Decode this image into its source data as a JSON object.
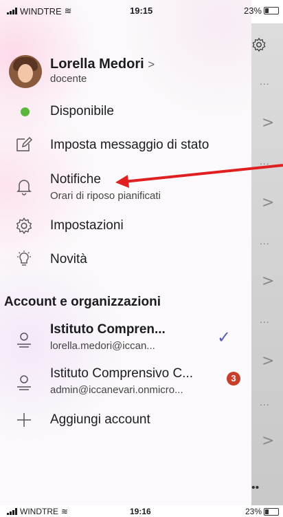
{
  "status_top": {
    "carrier": "WINDTRE",
    "time": "19:15",
    "battery": "23%"
  },
  "status_bottom": {
    "carrier": "WINDTRE",
    "time": "19:16",
    "battery": "23%"
  },
  "profile": {
    "name": "Lorella Medori",
    "chevron": ">",
    "role": "docente"
  },
  "menu": {
    "availability": "Disponibile",
    "set_status": "Imposta messaggio di stato",
    "notifications": "Notifiche",
    "notifications_sub": "Orari di riposo pianificati",
    "settings": "Impostazioni",
    "whats_new": "Novità"
  },
  "accounts": {
    "heading": "Account e organizzazioni",
    "items": [
      {
        "name": "Istituto Compren...",
        "email": "lorella.medori@iccan...",
        "checked": true
      },
      {
        "name": "Istituto Comprensivo C...",
        "email": "admin@iccanevari.onmicro...",
        "badge": "3"
      }
    ],
    "add": "Aggiungi account"
  },
  "background_strip": {
    "more": "...",
    "chevron": ">"
  },
  "colors": {
    "available": "#5bb63e",
    "badge": "#c8402c",
    "check": "#5a5fb0",
    "arrow": "#e02020"
  }
}
